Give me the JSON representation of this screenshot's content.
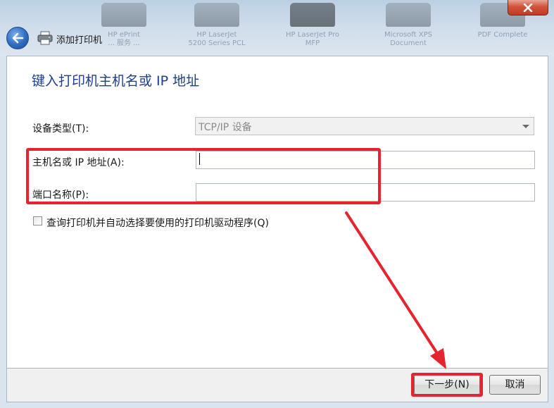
{
  "window": {
    "title": "添加打印机",
    "close_icon": "close-icon",
    "back_icon": "back-arrow-icon"
  },
  "background_devices": [
    {
      "label": "HP ePrint\n... 服务 ..."
    },
    {
      "label": "HP LaserJet\n5200 Series PCL"
    },
    {
      "label": "HP LaserJet Pro\nMFP"
    },
    {
      "label": "Microsoft XPS\nDocument"
    },
    {
      "label": "PDF Complete"
    }
  ],
  "page": {
    "heading": "键入打印机主机名或 IP 地址",
    "device_type_label": "设备类型(T):",
    "device_type_value": "TCP/IP 设备",
    "hostname_label": "主机名或 IP 地址(A):",
    "hostname_value": "",
    "port_label": "端口名称(P):",
    "port_value": "",
    "query_checkbox_label": "查询打印机并自动选择要使用的打印机驱动程序(Q)",
    "query_checked": false
  },
  "footer": {
    "next_label": "下一步(N)",
    "cancel_label": "取消"
  },
  "annotations": {
    "highlight_color": "#e4252f"
  }
}
